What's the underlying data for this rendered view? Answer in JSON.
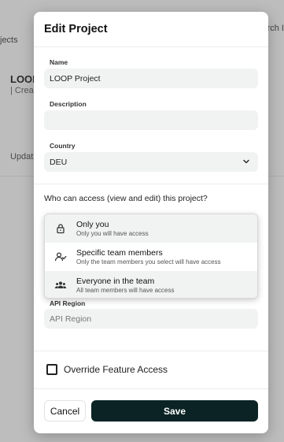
{
  "background": {
    "projects_fragment": "jects",
    "search_fragment": "rch I",
    "project_title": "LOOP",
    "created_fragment": "| Creat",
    "updated_fragment": "Update"
  },
  "modal": {
    "title": "Edit Project",
    "name_label": "Name",
    "name_value": "LOOP Project",
    "description_label": "Description",
    "description_value": "",
    "country_label": "Country",
    "country_value": "DEU",
    "access_question": "Who can access (view and edit) this project?",
    "access_options": [
      {
        "title": "Only you",
        "subtitle": "Only you will have access",
        "icon": "lock-icon"
      },
      {
        "title": "Specific team members",
        "subtitle": "Only the team members you select will have access",
        "icon": "user-check-icon"
      },
      {
        "title": "Everyone in the team",
        "subtitle": "All team members will have access",
        "icon": "users-icon"
      }
    ],
    "api_region_label": "API Region",
    "api_region_placeholder": "API Region",
    "override_label": "Override Feature Access",
    "cancel_label": "Cancel",
    "save_label": "Save"
  },
  "colors": {
    "primary_button": "#0b2324",
    "input_bg": "#f1f3f2"
  }
}
